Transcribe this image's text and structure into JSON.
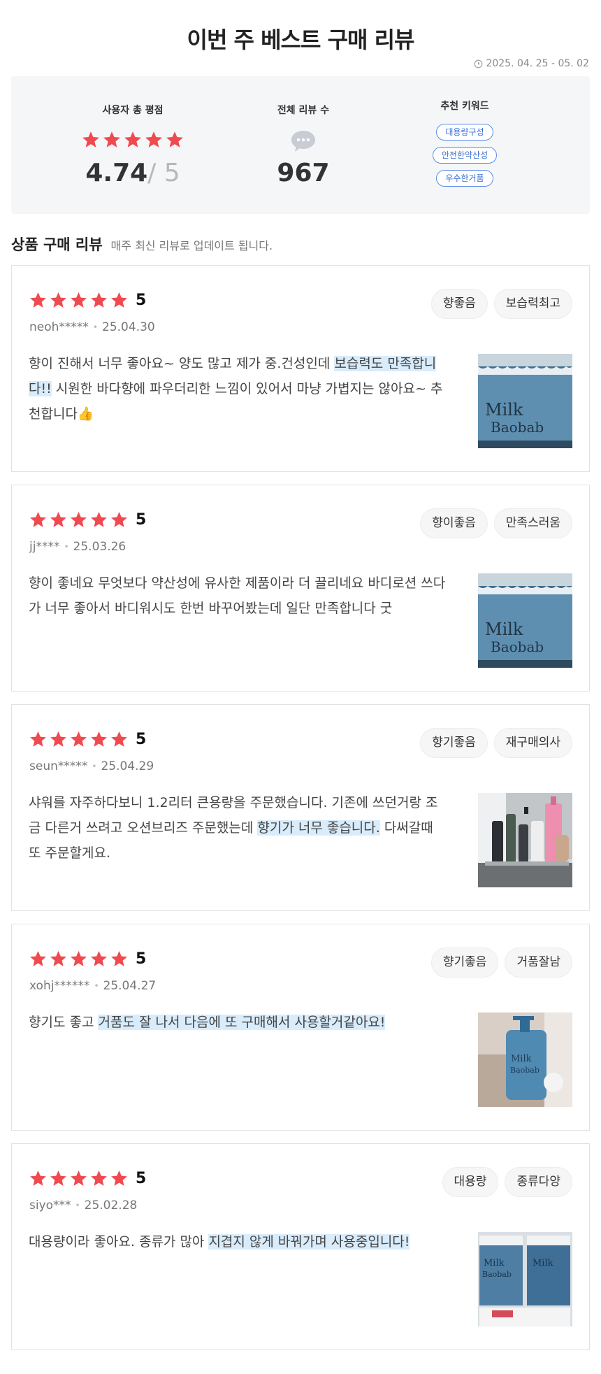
{
  "header": {
    "title": "이번 주 베스트 구매 리뷰",
    "period": "2025. 04. 25 - 05. 02"
  },
  "summary": {
    "rating_label": "사용자 총 평점",
    "rating": "4.74",
    "rating_max": "/ 5",
    "rating_stars": 5,
    "count_label": "전체 리뷰 수",
    "count": "967",
    "keyword_label": "추천 키워드",
    "keywords": [
      "대용량구성",
      "안전한약산성",
      "우수한거품"
    ]
  },
  "section": {
    "title": "상품 구매 리뷰",
    "subtitle": "매주 최신 리뷰로 업데이트 됩니다."
  },
  "colors": {
    "star": "#f0494f",
    "highlight": "#d9ecfb",
    "keyword_border": "#5b8de8"
  },
  "reviews": [
    {
      "stars": 5,
      "score": "5",
      "user": "neoh*****",
      "date": "25.04.30",
      "tags": [
        "향좋음",
        "보습력최고"
      ],
      "text_parts": [
        {
          "t": "향이 진해서 너무 좋아요~ 양도 많고 제가 중.건성인데 ",
          "hl": false
        },
        {
          "t": "보습력도 만족합니다!!",
          "hl": true
        },
        {
          "t": " 시원한 바다향에 파우더리한 느낌이 있어서 마냥 가볍지는 않아요~ 추천합니다👍",
          "hl": false
        }
      ],
      "image": "milk-baobab-box-photo"
    },
    {
      "stars": 5,
      "score": "5",
      "user": "jj****",
      "date": "25.03.26",
      "tags": [
        "향이좋음",
        "만족스러움"
      ],
      "text_parts": [
        {
          "t": "향이 좋네요 무엇보다 약산성에 유사한 제품이라 더 끌리네요 바디로션 쓰다가 너무 좋아서 바디워시도 한번 바꾸어봤는데 일단 만족합니다 굿",
          "hl": false
        }
      ],
      "image": "milk-baobab-box-photo"
    },
    {
      "stars": 5,
      "score": "5",
      "user": "seun*****",
      "date": "25.04.29",
      "tags": [
        "향기좋음",
        "재구매의사"
      ],
      "text_parts": [
        {
          "t": "샤워를 자주하다보니 1.2리터 큰용량을 주문했습니다. 기존에 쓰던거랑 조금 다른거 쓰려고 오션브리즈 주문했는데 ",
          "hl": false
        },
        {
          "t": "향기가 너무 좋습니다.",
          "hl": true
        },
        {
          "t": " 다써갈때 또 주문할게요.",
          "hl": false
        }
      ],
      "image": "bathroom-shelf-photo"
    },
    {
      "stars": 5,
      "score": "5",
      "user": "xohj******",
      "date": "25.04.27",
      "tags": [
        "향기좋음",
        "거품잘남"
      ],
      "text_parts": [
        {
          "t": "향기도 좋고 ",
          "hl": false
        },
        {
          "t": "거품도 잘 나서 다음에 또 구매해서 사용할거같아요!",
          "hl": true
        }
      ],
      "image": "pump-bottle-photo"
    },
    {
      "stars": 5,
      "score": "5",
      "user": "siyo***",
      "date": "25.02.28",
      "tags": [
        "대용량",
        "종류다양"
      ],
      "text_parts": [
        {
          "t": "대용량이라 좋아요. 종류가 많아 ",
          "hl": false
        },
        {
          "t": "지겹지 않게 바꿔가며 사용중입니다!",
          "hl": true
        }
      ],
      "image": "multiple-boxes-photo"
    }
  ]
}
